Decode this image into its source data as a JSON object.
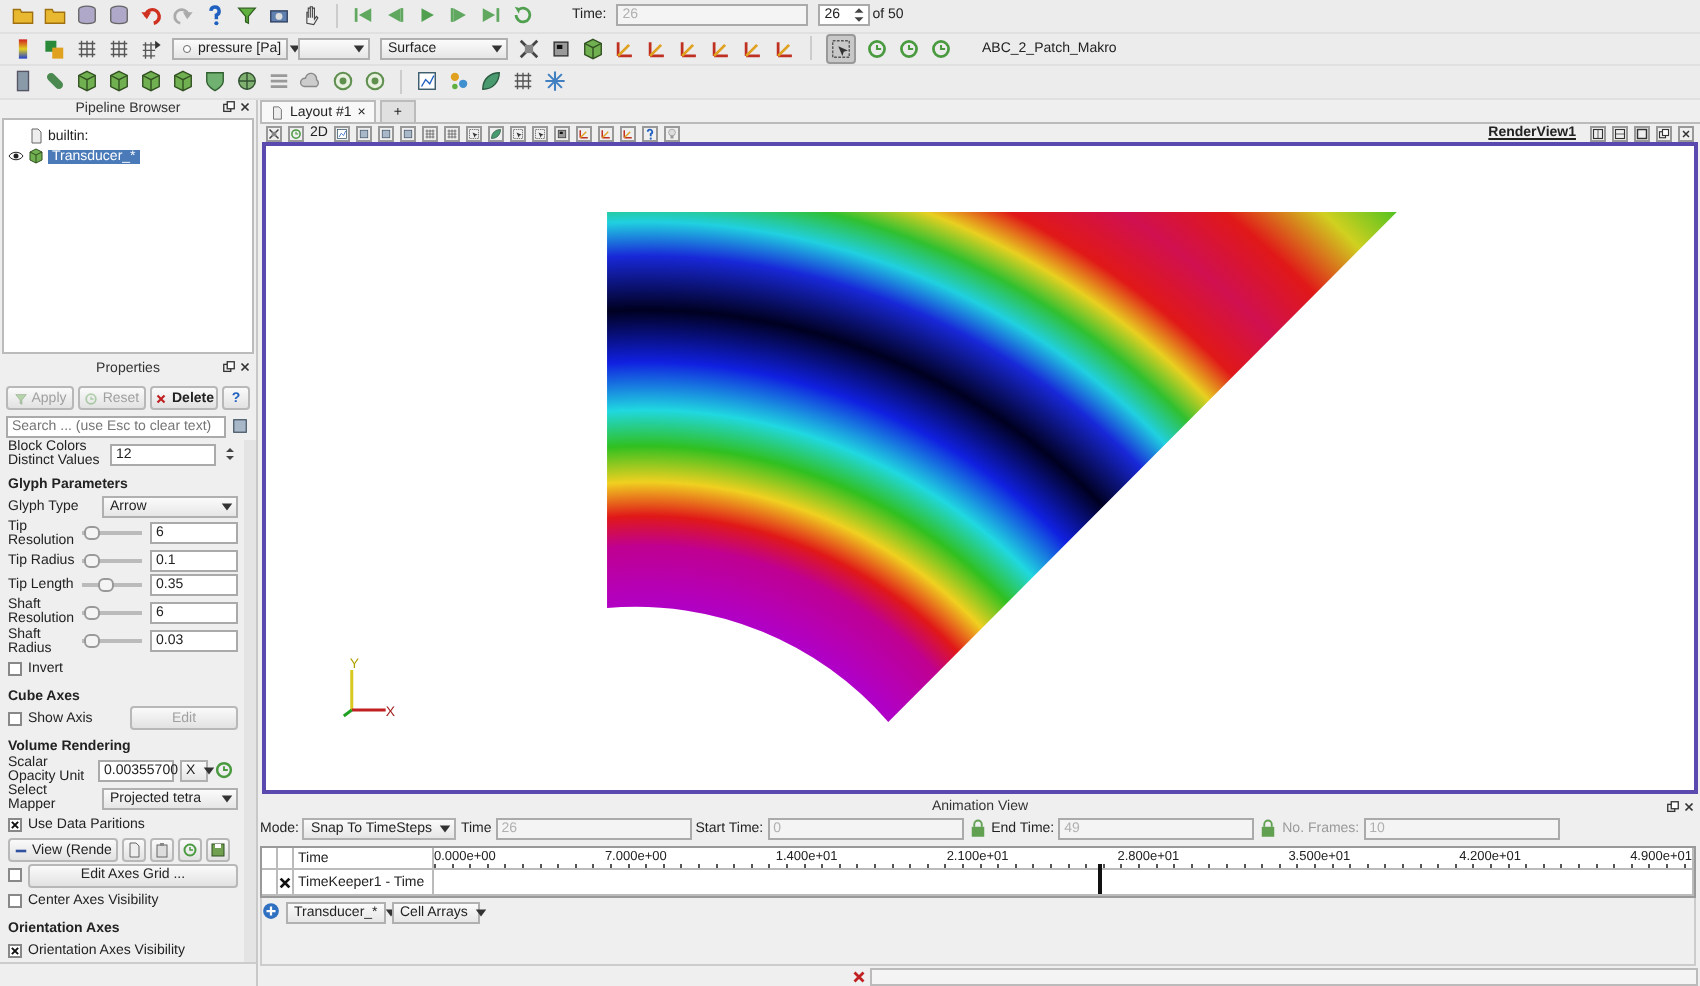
{
  "toolbar": {
    "time_label": "Time:",
    "time_field": {
      "value": "26",
      "disabled": true
    },
    "time_step": "26",
    "time_total": "of 50",
    "array_dropdown": "pressure [Pa]",
    "representation_dropdown": "Surface",
    "mode_toggle": {
      "on": true
    },
    "macro": "ABC_2_Patch_Makro"
  },
  "pipeline_browser": {
    "title": "Pipeline Browser",
    "items": [
      {
        "label": "builtin:",
        "selected": false,
        "children": [
          {
            "label": "Transducer_*",
            "selected": true,
            "visible": true
          }
        ]
      }
    ]
  },
  "properties": {
    "title": "Properties",
    "buttons": [
      {
        "label": "Apply",
        "kind": "apply",
        "disabled": true
      },
      {
        "label": "Reset",
        "kind": "reset",
        "disabled": true
      },
      {
        "label": "Delete",
        "kind": "delete",
        "disabled": false
      },
      {
        "label": "?",
        "kind": "help",
        "disabled": false
      }
    ],
    "search_placeholder": "Search ... (use Esc to clear text)",
    "rows": [
      {
        "kind": "field",
        "label": "Block Colors Distinct Values",
        "value": "12"
      },
      {
        "kind": "heading",
        "label": "Glyph Parameters"
      },
      {
        "kind": "dropdown",
        "label": "Glyph Type",
        "value": "Arrow"
      },
      {
        "kind": "slider",
        "label": "Tip Resolution",
        "value": "6",
        "level": 0.05
      },
      {
        "kind": "slider",
        "label": "Tip Radius",
        "value": "0.1",
        "level": 0.05
      },
      {
        "kind": "slider",
        "label": "Tip Length",
        "value": "0.35",
        "level": 0.35
      },
      {
        "kind": "slider",
        "label": "Shaft Resolution",
        "value": "6",
        "level": 0.05
      },
      {
        "kind": "slider",
        "label": "Shaft Radius",
        "value": "0.03",
        "level": 0.05
      },
      {
        "kind": "checkbox",
        "label": "Invert",
        "checked": false
      },
      {
        "kind": "heading",
        "label": "Cube Axes"
      },
      {
        "kind": "checkbox_button",
        "label": "Show Axis",
        "checked": false,
        "button": "Edit",
        "disabled": true
      },
      {
        "kind": "heading",
        "label": "Volume Rendering"
      },
      {
        "kind": "unit",
        "label": "Scalar Opacity Unit",
        "value": "0.00355700",
        "option": "X"
      },
      {
        "kind": "dropdown",
        "label": "Select Mapper",
        "value": "Projected tetra"
      },
      {
        "kind": "checkbox",
        "label": "Use Data Paritions",
        "checked": true
      },
      {
        "kind": "view_buttons",
        "label": "View (Rende"
      },
      {
        "kind": "checkbox_wide",
        "button": "Edit Axes Grid ...",
        "checked": false
      },
      {
        "kind": "checkbox",
        "label": "Center Axes Visibility",
        "checked": false
      },
      {
        "kind": "heading",
        "label": "Orientation Axes"
      },
      {
        "kind": "checkbox",
        "label": "Orientation Axes Visibility",
        "checked": true
      }
    ]
  },
  "layout": {
    "tabs": [
      {
        "label": "Layout #1",
        "close": "×",
        "selected": true
      },
      {
        "label": "+",
        "selected": false
      }
    ],
    "view_toolbar_2d": "2D",
    "view_title": "RenderView1",
    "axes_labels": [
      "Y",
      "X"
    ]
  },
  "animation": {
    "title": "Animation View",
    "mode_label": "Mode:",
    "mode": "Snap To TimeSteps",
    "time_label": "Time",
    "time": {
      "value": "26",
      "disabled": true
    },
    "start_label": "Start Time:",
    "start": {
      "value": "0",
      "disabled": true
    },
    "end_label": "End Time:",
    "end": {
      "value": "49",
      "disabled": true
    },
    "frames_label": "No. Frames:",
    "frames": {
      "value": "10",
      "disabled": true
    },
    "header": "Time",
    "ticks": [
      "0.000e+00",
      "7.000e+00",
      "1.400e+01",
      "2.100e+01",
      "2.800e+01",
      "3.500e+01",
      "4.200e+01",
      "4.900e+01"
    ],
    "track": "TimeKeeper1 - Time",
    "track_checked": true,
    "cursor": {
      "level": 0.53
    },
    "source": "Transducer_*",
    "arrays": "Cell Arrays"
  }
}
